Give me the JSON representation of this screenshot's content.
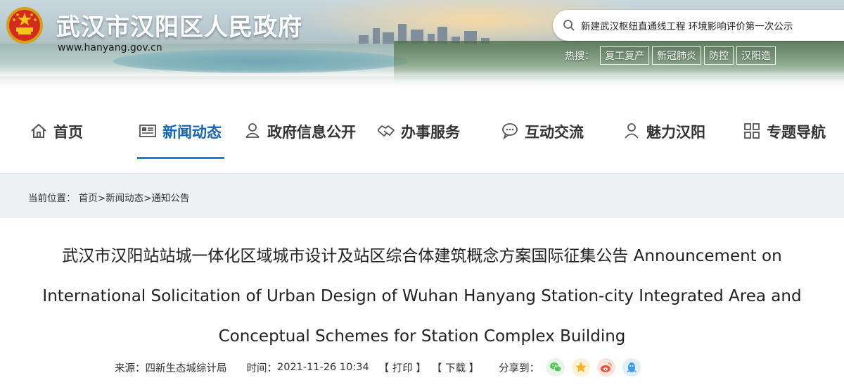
{
  "header": {
    "site_title": "武汉市汉阳区人民政府",
    "site_url": "www.hanyang.gov.cn",
    "search_value": "新建武汉枢纽直通线工程 环境影响评价第一次公示",
    "hot_label": "热搜：",
    "hot_tags": [
      "复工复产",
      "新冠肺炎",
      "防控",
      "汉阳造"
    ]
  },
  "nav": {
    "items": [
      {
        "label": "首页",
        "icon": "home-icon"
      },
      {
        "label": "新闻动态",
        "icon": "news-icon",
        "active": true
      },
      {
        "label": "政府信息公开",
        "icon": "info-icon"
      },
      {
        "label": "办事服务",
        "icon": "handshake-icon"
      },
      {
        "label": "互动交流",
        "icon": "chat-icon"
      },
      {
        "label": "魅力汉阳",
        "icon": "person-icon"
      },
      {
        "label": "专题导航",
        "icon": "grid-icon"
      }
    ]
  },
  "breadcrumb": {
    "prefix": "当前位置：",
    "items": [
      "首页",
      "新闻动态",
      "通知公告"
    ],
    "sep": ">"
  },
  "article": {
    "title": "武汉市汉阳站站城一体化区域城市设计及站区综合体建筑概念方案国际征集公告 Announcement on International Solicitation of Urban Design of Wuhan Hanyang Station-city Integrated Area and Conceptual Schemes for Station Complex Building",
    "source_label": "来源：",
    "source": "四新生态城综计局",
    "time_label": "时间：",
    "time": "2021-11-26 10:34",
    "print_label": "【 打印 】",
    "download_label": "【 下载 】",
    "share_label": "分享到：",
    "share_icons": [
      {
        "name": "wechat-icon",
        "color": "#5cc25b"
      },
      {
        "name": "qzone-star-icon",
        "color": "#f6b52d"
      },
      {
        "name": "weibo-icon",
        "color": "#e9533a"
      },
      {
        "name": "qq-icon",
        "color": "#3b9be8"
      }
    ]
  },
  "colors": {
    "accent": "#1565b5",
    "underline": "#1e7fd8",
    "crumb_bg": "#eef1f4"
  }
}
